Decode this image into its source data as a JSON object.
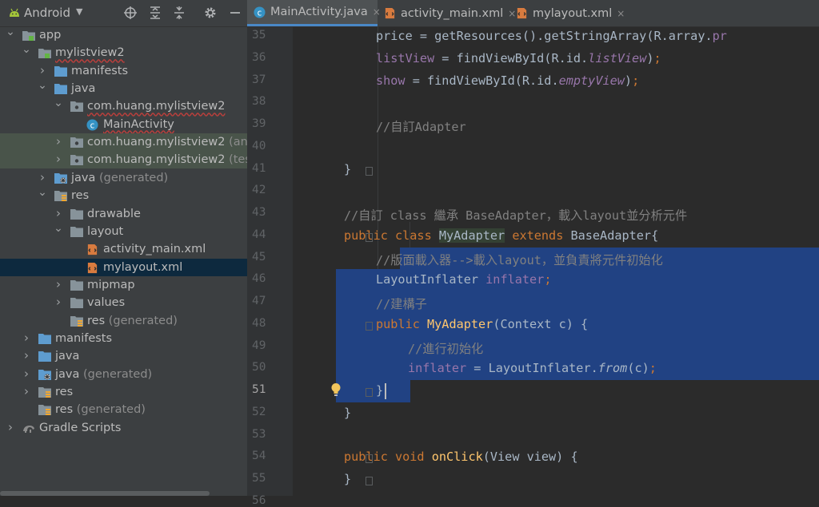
{
  "project_panel": {
    "view_mode": "Android",
    "toolbar_icons": [
      "locate-icon",
      "expand-all-icon",
      "collapse-all-icon",
      "settings-gear-icon",
      "hide-icon"
    ],
    "tree": [
      {
        "label": "app",
        "indent": 0,
        "expanded": true,
        "icon": "module"
      },
      {
        "label": "mylistview2",
        "indent": 1,
        "expanded": true,
        "icon": "module",
        "squiggle": true
      },
      {
        "label": "manifests",
        "indent": 2,
        "expanded": false,
        "icon": "folder"
      },
      {
        "label": "java",
        "indent": 2,
        "expanded": true,
        "icon": "folder"
      },
      {
        "label": "com.huang.mylistview2",
        "indent": 3,
        "expanded": true,
        "icon": "package",
        "squiggle": true
      },
      {
        "label": "MainActivity",
        "indent": 4,
        "leaf": true,
        "icon": "class",
        "squiggle": true
      },
      {
        "label": "com.huang.mylistview2",
        "suffix": "(andro",
        "indent": 3,
        "expanded": false,
        "icon": "package",
        "highlight": true
      },
      {
        "label": "com.huang.mylistview2",
        "suffix": "(test)",
        "indent": 3,
        "expanded": false,
        "icon": "package",
        "highlight": true
      },
      {
        "label": "java",
        "suffix": "(generated)",
        "indent": 2,
        "expanded": false,
        "icon": "gen-folder"
      },
      {
        "label": "res",
        "indent": 2,
        "expanded": true,
        "icon": "res-folder"
      },
      {
        "label": "drawable",
        "indent": 3,
        "expanded": false,
        "icon": "dark-folder"
      },
      {
        "label": "layout",
        "indent": 3,
        "expanded": true,
        "icon": "dark-folder"
      },
      {
        "label": "activity_main.xml",
        "indent": 4,
        "leaf": true,
        "icon": "xml"
      },
      {
        "label": "mylayout.xml",
        "indent": 4,
        "leaf": true,
        "icon": "xml",
        "selected": true
      },
      {
        "label": "mipmap",
        "indent": 3,
        "expanded": false,
        "icon": "dark-folder"
      },
      {
        "label": "values",
        "indent": 3,
        "expanded": false,
        "icon": "dark-folder"
      },
      {
        "label": "res",
        "suffix": "(generated)",
        "indent": 3,
        "leaf": true,
        "icon": "res-folder"
      },
      {
        "label": "manifests",
        "indent": 1,
        "expanded": false,
        "icon": "folder"
      },
      {
        "label": "java",
        "indent": 1,
        "expanded": false,
        "icon": "folder"
      },
      {
        "label": "java",
        "suffix": "(generated)",
        "indent": 1,
        "expanded": false,
        "icon": "gen-folder"
      },
      {
        "label": "res",
        "indent": 1,
        "expanded": false,
        "icon": "res-folder"
      },
      {
        "label": "res",
        "suffix": "(generated)",
        "indent": 1,
        "leaf": true,
        "icon": "res-folder"
      },
      {
        "label": "Gradle Scripts",
        "indent": 0,
        "expanded": false,
        "icon": "gradle"
      }
    ]
  },
  "tabs": [
    {
      "label": "MainActivity.java",
      "active": true,
      "icon": "class"
    },
    {
      "label": "activity_main.xml",
      "active": false,
      "icon": "xml"
    },
    {
      "label": "mylayout.xml",
      "active": false,
      "icon": "xml"
    }
  ],
  "editor": {
    "colors": {
      "keyword": "#cc7832",
      "method": "#ffc66d",
      "comment": "#808080",
      "field": "#9876aa",
      "text": "#a9b7c6",
      "selection": "#214283"
    },
    "caret_line": 51,
    "lines": [
      {
        "n": "35",
        "indent": 2,
        "tokens": [
          [
            "t",
            "price = getResources().getStringArray(R.array."
          ],
          [
            "fd",
            "pr"
          ]
        ]
      },
      {
        "n": "36",
        "indent": 2,
        "tokens": [
          [
            "fd",
            "listView"
          ],
          [
            "t",
            " = findViewById(R.id."
          ],
          [
            "fdi",
            "listView"
          ],
          [
            "t",
            ")"
          ],
          [
            "kw",
            ";"
          ]
        ]
      },
      {
        "n": "37",
        "indent": 2,
        "tokens": [
          [
            "fd",
            "show"
          ],
          [
            "t",
            " = findViewById(R.id."
          ],
          [
            "fdi",
            "emptyView"
          ],
          [
            "t",
            ")"
          ],
          [
            "kw",
            ";"
          ]
        ]
      },
      {
        "n": "38",
        "indent": 0,
        "tokens": []
      },
      {
        "n": "39",
        "indent": 2,
        "tokens": [
          [
            "cm",
            "//自訂Adapter"
          ]
        ]
      },
      {
        "n": "40",
        "indent": 0,
        "tokens": []
      },
      {
        "n": "41",
        "indent": 1,
        "tokens": [
          [
            "t",
            "}"
          ]
        ]
      },
      {
        "n": "42",
        "indent": 0,
        "tokens": []
      },
      {
        "n": "43",
        "indent": 1,
        "tokens": [
          [
            "cm",
            "//自訂 class 繼承 BaseAdapter，載入layout並分析元件"
          ]
        ]
      },
      {
        "n": "44",
        "indent": 1,
        "tokens": [
          [
            "kw",
            "public class "
          ],
          [
            "hlcls",
            "MyAdapter"
          ],
          [
            "t",
            " "
          ],
          [
            "kw",
            "extends "
          ],
          [
            "t",
            "BaseAdapter{"
          ]
        ]
      },
      {
        "n": "45",
        "indent": 2,
        "tokens": [
          [
            "cm",
            "//版面載入器-->載入layout，並負責將元件初始化"
          ]
        ]
      },
      {
        "n": "46",
        "indent": 2,
        "tokens": [
          [
            "t",
            "LayoutInflater "
          ],
          [
            "fd",
            "inflater"
          ],
          [
            "kw",
            ";"
          ]
        ]
      },
      {
        "n": "47",
        "indent": 2,
        "tokens": [
          [
            "cm",
            "//建構子"
          ]
        ]
      },
      {
        "n": "48",
        "indent": 2,
        "tokens": [
          [
            "kw",
            "public "
          ],
          [
            "fn",
            "MyAdapter"
          ],
          [
            "t",
            "(Context c) {"
          ]
        ]
      },
      {
        "n": "49",
        "indent": 3,
        "tokens": [
          [
            "cm",
            "//進行初始化"
          ]
        ]
      },
      {
        "n": "50",
        "indent": 3,
        "tokens": [
          [
            "fd",
            "inflater"
          ],
          [
            "t",
            " = LayoutInflater."
          ],
          [
            "it",
            "from"
          ],
          [
            "t",
            "(c)"
          ],
          [
            "kw",
            ";"
          ]
        ]
      },
      {
        "n": "51",
        "indent": 2,
        "tokens": [
          [
            "t",
            "}"
          ]
        ]
      },
      {
        "n": "52",
        "indent": 1,
        "tokens": [
          [
            "t",
            "}"
          ]
        ]
      },
      {
        "n": "53",
        "indent": 0,
        "tokens": []
      },
      {
        "n": "54",
        "indent": 1,
        "tokens": [
          [
            "kw",
            "public void "
          ],
          [
            "fn",
            "onClick"
          ],
          [
            "t",
            "(View view) {"
          ]
        ]
      },
      {
        "n": "55",
        "indent": 1,
        "tokens": [
          [
            "t",
            "}"
          ]
        ]
      },
      {
        "n": "56",
        "indent": 0,
        "tokens": [
          [
            "t",
            "}"
          ]
        ]
      }
    ]
  }
}
